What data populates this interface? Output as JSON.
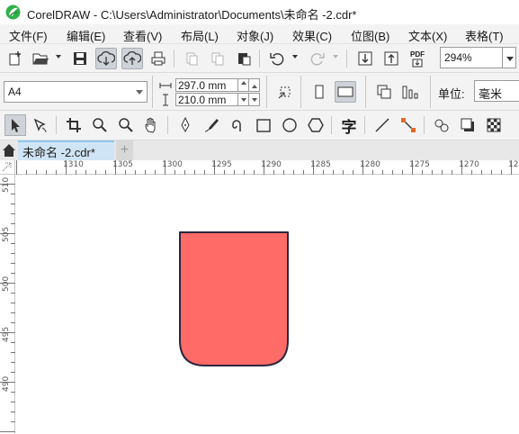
{
  "window": {
    "title": "CorelDRAW - C:\\Users\\Administrator\\Documents\\未命名 -2.cdr*"
  },
  "menu": {
    "items": [
      {
        "label": "文件(F)"
      },
      {
        "label": "编辑(E)"
      },
      {
        "label": "查看(V)"
      },
      {
        "label": "布局(L)"
      },
      {
        "label": "对象(J)"
      },
      {
        "label": "效果(C)"
      },
      {
        "label": "位图(B)"
      },
      {
        "label": "文本(X)"
      },
      {
        "label": "表格(T)"
      }
    ]
  },
  "toolbar": {
    "zoom_value": "294%",
    "pdf_label": "PDF",
    "icons": [
      "new-document-icon",
      "open-folder-icon",
      "save-icon",
      "cloud-download-icon",
      "cloud-upload-icon",
      "print-icon",
      "cut-icon",
      "copy-icon",
      "paste-icon",
      "undo-icon",
      "redo-icon",
      "import-icon",
      "export-icon",
      "publish-pdf-icon"
    ]
  },
  "property_bar": {
    "page_size": "A4",
    "width": "297.0 mm",
    "height": "210.0 mm",
    "unit_label": "单位:",
    "unit_value": "毫米"
  },
  "toolbox": {
    "text_tool_glyph": "字",
    "icons": [
      "pick-tool-icon",
      "shape-tool-icon",
      "crop-tool-icon",
      "zoom-tool-icon",
      "zoom-tool-icon-2",
      "pan-tool-icon",
      "pen-tool-icon",
      "artistic-media-icon",
      "spiral-icon",
      "rectangle-tool-icon",
      "ellipse-tool-icon",
      "polygon-tool-icon",
      "text-tool-icon",
      "connector-tool-icon",
      "dimension-tool-icon",
      "blend-tool-icon",
      "drop-shadow-icon",
      "transparency-icon"
    ]
  },
  "document_tab": {
    "label": "未命名 -2.cdr*",
    "add_label": "+"
  },
  "rulers": {
    "horizontal_labels": [
      "1310",
      "1305",
      "1300",
      "1295",
      "1290",
      "1285",
      "1280",
      "1275",
      "1270",
      "12"
    ],
    "vertical_labels": [
      "510",
      "505",
      "500",
      "495",
      "490"
    ]
  },
  "shape": {
    "fill": "#ff6b67",
    "stroke": "#2b2640"
  },
  "colors": {
    "logo_green": "#2fb24a",
    "tab_active": "#cfe5f5"
  }
}
